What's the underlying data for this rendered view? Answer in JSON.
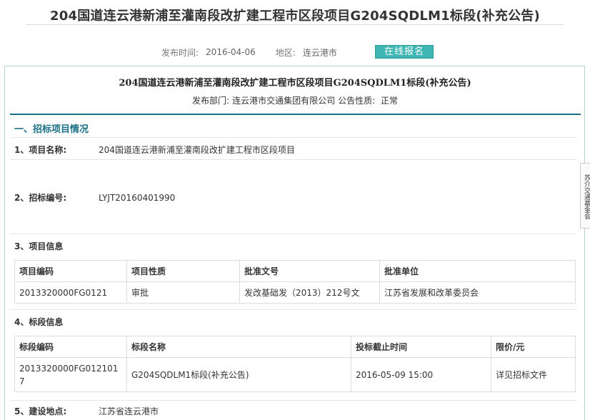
{
  "page_title": "204国道连云港新浦至灌南段改扩建工程市区段项目G204SQDLM1标段(补充公告)",
  "meta": {
    "publish_label": "发布时间:",
    "publish_date": "2016-04-06",
    "region_label": "地区:",
    "region": "连云港市",
    "apply_button": "在线报名"
  },
  "notice": {
    "title": "204国道连云港新浦至灌南段改扩建工程市区段项目G204SQDLM1标段(补充公告)",
    "dept_label": "发布部门:",
    "dept": "连云港市交通集团有限公司",
    "nature_label": "公告性质:",
    "nature": "正常"
  },
  "section1": {
    "heading": "一、招标项目情况"
  },
  "fields": {
    "project_name_label": "1、项目名称:",
    "project_name": "204国道连云港新浦至灌南段改扩建工程市区段项目",
    "bid_no_label": "2、招标编号:",
    "bid_no": "LYJT20160401990",
    "project_info_label": "3、项目信息",
    "section_info_label": "4、标段信息",
    "location_label": "5、建设地点:",
    "location": "江苏省连云港市"
  },
  "project_table": {
    "headers": [
      "项目编码",
      "项目性质",
      "批准文号",
      "批准单位"
    ],
    "row": [
      "2013320000FG0121",
      "审批",
      "发改基础发（2013）212号文",
      "江苏省发展和改革委员会"
    ]
  },
  "section_table": {
    "headers": [
      "标段编码",
      "标段名称",
      "投标截止时间",
      "限价/元"
    ],
    "row": [
      "2013320000FG012101 7",
      "G204SQDLM1标段(补充公告)",
      "2016-05-09 15:00",
      "详见招标文件"
    ]
  },
  "side_tab": {
    "label": "苏介交通基金会"
  },
  "colors": {
    "accent": "#1b6f86",
    "button": "#3fb6b4"
  }
}
